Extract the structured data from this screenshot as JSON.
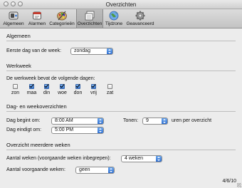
{
  "window": {
    "title": "Overzichten"
  },
  "toolbar": {
    "items": [
      {
        "label": "Algemeen",
        "icon": "switch-icon"
      },
      {
        "label": "Alarmen",
        "icon": "alarm-clock-icon"
      },
      {
        "label": "Categorieën",
        "icon": "palette-icon"
      },
      {
        "label": "Overzichten",
        "icon": "views-icon"
      },
      {
        "label": "Tijdzone",
        "icon": "globe-icon"
      },
      {
        "label": "Geavanceerd",
        "icon": "gear-icon"
      }
    ],
    "active": "Overzichten"
  },
  "general": {
    "title": "Algemeen",
    "first_day_label": "Eerste dag van de week:",
    "first_day_value": "zondag"
  },
  "workweek": {
    "title": "Werkweek",
    "contains_label": "De werkweek bevat de volgende dagen:",
    "days": [
      {
        "label": "zon",
        "checked": false
      },
      {
        "label": "maa",
        "checked": true
      },
      {
        "label": "din",
        "checked": true
      },
      {
        "label": "woe",
        "checked": true
      },
      {
        "label": "don",
        "checked": true
      },
      {
        "label": "vrij",
        "checked": true
      },
      {
        "label": "zat",
        "checked": false
      }
    ]
  },
  "day_week_views": {
    "title": "Dag- en weekoverzichten",
    "day_start_label": "Dag begint om:",
    "day_start_value": "8:00 AM",
    "day_end_label": "Dag eindigt om:",
    "day_end_value": "5:00 PM",
    "show_label": "Tonen:",
    "show_value": "9",
    "hours_suffix": "uren per overzicht"
  },
  "multiweek": {
    "title": "Overzicht meerdere weken",
    "weeks_label": "Aantal weken (voorgaande weken inbegrepen):",
    "weeks_value": "4 weken",
    "previous_label": "Aantal voorgaande weken:",
    "previous_value": "geen"
  },
  "footer": {
    "version": "4/6/10"
  },
  "colors": {
    "accent": "#3c7cd6",
    "background": "#ececec"
  }
}
